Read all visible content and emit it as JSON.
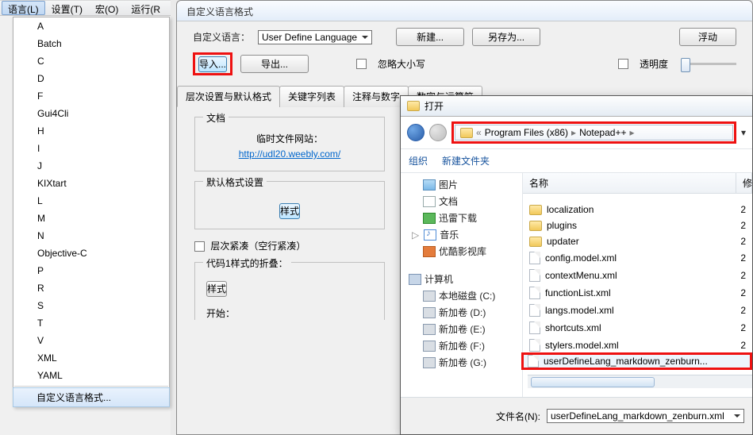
{
  "menubar": {
    "lang": "语言(L)",
    "settings": "设置(T)",
    "macro": "宏(O)",
    "run": "运行(R"
  },
  "lang_list": [
    "A",
    "Batch",
    "C",
    "D",
    "F",
    "Gui4Cli",
    "H",
    "I",
    "J",
    "KIXtart",
    "L",
    "M",
    "N",
    "Objective-C",
    "P",
    "R",
    "S",
    "T",
    "V",
    "XML",
    "YAML"
  ],
  "lang_custom": "自定义语言格式...",
  "udl": {
    "title": "自定义语言格式",
    "lang_label": "自定义语言：",
    "lang_combo": "User Define Language",
    "new_btn": "新建...",
    "saveas_btn": "另存为...",
    "float_btn": "浮动",
    "import_btn": "导入...",
    "export_btn": "导出...",
    "ignore_case": "忽略大小写",
    "transparent": "透明度",
    "tabs": [
      "层次设置与默认格式",
      "关键字列表",
      "注释与数字",
      "数字与运算符"
    ],
    "doc_label": "文档",
    "temp_site": "临时文件网站：",
    "temp_url": "http://udl20.weebly.com/",
    "default_fmt": "默认格式设置",
    "style_btn": "样式",
    "compact": "层次紧凑（空行紧凑）",
    "fold_label": "代码1样式的折叠：",
    "style2_btn": "样式",
    "start_label": "开始："
  },
  "open": {
    "title": "打开",
    "crumb": [
      "Program Files (x86)",
      "Notepad++"
    ],
    "organize": "组织",
    "newfolder": "新建文件夹",
    "tree": {
      "pics": "图片",
      "docs": "文档",
      "xunlei": "迅雷下载",
      "music": "音乐",
      "video": "优酷影视库",
      "computer": "计算机",
      "c": "本地磁盘 (C:)",
      "d": "新加卷 (D:)",
      "e": "新加卷 (E:)",
      "f": "新加卷 (F:)",
      "g": "新加卷 (G:)"
    },
    "hdr_name": "名称",
    "hdr_mod": "修",
    "files": [
      {
        "t": "folder",
        "n": "localization",
        "m": "2"
      },
      {
        "t": "folder",
        "n": "plugins",
        "m": "2"
      },
      {
        "t": "folder",
        "n": "updater",
        "m": "2"
      },
      {
        "t": "xml",
        "n": "config.model.xml",
        "m": "2"
      },
      {
        "t": "xml",
        "n": "contextMenu.xml",
        "m": "2"
      },
      {
        "t": "xml",
        "n": "functionList.xml",
        "m": "2"
      },
      {
        "t": "xml",
        "n": "langs.model.xml",
        "m": "2"
      },
      {
        "t": "xml",
        "n": "shortcuts.xml",
        "m": "2"
      },
      {
        "t": "xml",
        "n": "stylers.model.xml",
        "m": "2"
      },
      {
        "t": "xml",
        "n": "userDefineLang_markdown_zenburn...",
        "m": ""
      }
    ],
    "fname_label": "文件名(N):",
    "fname_value": "userDefineLang_markdown_zenburn.xml"
  }
}
